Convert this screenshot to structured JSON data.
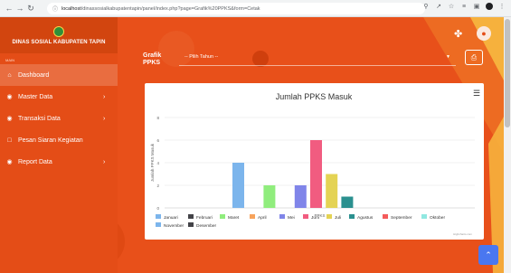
{
  "browser": {
    "url_host": "localhost",
    "url_path": "/dinassosialkabupatentapin/panel/index.php?page=Grafik%20PPKS&form=Cetak"
  },
  "sidebar": {
    "brand_title": "DINAS SOSIAL KABUPATEN TAPIN",
    "section_label": "MAIN",
    "items": [
      {
        "label": "Dashboard",
        "icon": "home-icon",
        "active": true,
        "has_chevron": false
      },
      {
        "label": "Master Data",
        "icon": "circle-dot-icon",
        "active": false,
        "has_chevron": true
      },
      {
        "label": "Transaksi Data",
        "icon": "circle-dot-icon",
        "active": false,
        "has_chevron": true
      },
      {
        "label": "Pesan Siaran Kegiatan",
        "icon": "clipboard-icon",
        "active": false,
        "has_chevron": false
      },
      {
        "label": "Report Data",
        "icon": "circle-dot-icon",
        "active": false,
        "has_chevron": true
      }
    ]
  },
  "filter": {
    "label": "Grafik PPKS",
    "select_value": "-- Pilih Tahun --"
  },
  "colors": {
    "accent": "#e8501a",
    "sidebar": "#e44d17",
    "scroll_button": "#4a77f0"
  },
  "chart_data": {
    "type": "bar",
    "title": "Jumlah PPKS Masuk",
    "xlabel": "PPKS",
    "ylabel": "Jumlah PPKS Masuk",
    "ylim": [
      0,
      8
    ],
    "yticks": [
      0,
      2,
      4,
      6,
      8
    ],
    "grid": true,
    "legend_position": "bottom",
    "categories": [
      "PPKS"
    ],
    "series": [
      {
        "name": "Januari",
        "values": [
          4
        ],
        "color": "#7cb5ec"
      },
      {
        "name": "Februari",
        "values": [
          0
        ],
        "color": "#434348"
      },
      {
        "name": "Maret",
        "values": [
          2
        ],
        "color": "#90ed7d"
      },
      {
        "name": "April",
        "values": [
          0
        ],
        "color": "#f7a35c"
      },
      {
        "name": "Mei",
        "values": [
          2
        ],
        "color": "#8085e9"
      },
      {
        "name": "Juni",
        "values": [
          6
        ],
        "color": "#f15c80"
      },
      {
        "name": "Juli",
        "values": [
          3
        ],
        "color": "#e4d354"
      },
      {
        "name": "Agustus",
        "values": [
          1
        ],
        "color": "#2b908f"
      },
      {
        "name": "September",
        "values": [
          0
        ],
        "color": "#f45b5b"
      },
      {
        "name": "Oktober",
        "values": [
          0
        ],
        "color": "#91e8e1"
      },
      {
        "name": "November",
        "values": [
          0
        ],
        "color": "#7cb5ec"
      },
      {
        "name": "Desember",
        "values": [
          0
        ],
        "color": "#434348"
      }
    ],
    "credits": "Highcharts.com"
  }
}
